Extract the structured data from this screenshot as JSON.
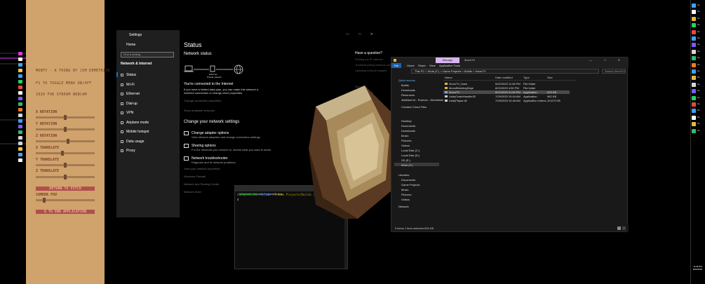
{
  "tool_panel": {
    "credit": "MONTY - A THING BY JIM DEMETRIOU",
    "toggle_hint": "F1 TO TOGGLE MENU ON/OFF",
    "stream_size": "1920 FOR STREAM WEBCAM",
    "sliders": [
      {
        "label": "X ROTATION",
        "value": 0.5
      },
      {
        "label": "Y ROTATION",
        "value": 0.5
      },
      {
        "label": "Z ROTATION",
        "value": 0.55
      },
      {
        "label": "X TRANSLATE",
        "value": 0.45
      },
      {
        "label": "Y TRANSLATE",
        "value": 0.5
      },
      {
        "label": "Z TRANSLATE",
        "value": 0.5
      }
    ],
    "reset_label": "RETURN TO PITCH",
    "fov_label": "CAMERA FOV",
    "fov_value": 0.12,
    "quit_label": "Q TO END APPLICATION"
  },
  "settings": {
    "window_title": "Settings",
    "home": "Home",
    "search_placeholder": "Find a setting",
    "category": "Network & Internet",
    "nav_items": [
      "Status",
      "Wi-Fi",
      "Ethernet",
      "Dial-up",
      "VPN",
      "Airplane mode",
      "Mobile hotspot",
      "Data usage",
      "Proxy"
    ],
    "heading": "Status",
    "network_status": "Network status",
    "ethernet_caption_1": "Ethernet",
    "ethernet_caption_2": "Private network",
    "connected": "You're connected to the Internet",
    "metered_text_1": "If you have a limited data plan, you can make this network a",
    "metered_text_2": "metered connection or change other properties.",
    "change_props": "Change connection properties",
    "show_networks": "Show available networks",
    "change_heading": "Change your network settings",
    "options": [
      {
        "title": "Change adapter options",
        "sub": "View network adapters and change connection settings."
      },
      {
        "title": "Sharing options",
        "sub": "For the networks you connect to, decide what you want to share."
      },
      {
        "title": "Network troubleshooter",
        "sub": "Diagnose and fix network problems."
      }
    ],
    "links": [
      "View your network properties",
      "Windows Firewall",
      "Network and Sharing Center",
      "Network reset"
    ],
    "question_title": "Have a question?",
    "question_links": [
      "Finding my IP address",
      "Troubleshooting network connection issues",
      "Updating network adapter"
    ],
    "help_links": [
      "Get help",
      "Give feedback"
    ]
  },
  "terminal": {
    "title": "MINGW64:/f/Game Projects/Builds",
    "prompt_user": "USER@MACHINE",
    "prompt_env": "MINGW64",
    "prompt_path": "/f/Game Projects/Builds",
    "prompt_branch": "(master)",
    "prompt_symbol": "$"
  },
  "explorer": {
    "tab_label": "Manage",
    "title": "3monTV",
    "window_controls": "— □ ✕",
    "ribbon": [
      "File",
      "Home",
      "Share",
      "View",
      "Application Tools"
    ],
    "address": "This PC  >  Work (F:)  >  Game Projects  >  Builds  >  3monTV",
    "search_placeholder": "Search 3monTV",
    "nav": [
      "Quick access",
      "Builds",
      "Downloads",
      "Resources",
      "3dsMaxCut - Rumors - Worldwide",
      "Creative Cloud Files",
      "Desktop",
      "Documents",
      "Downloads",
      "Music",
      "Pictures",
      "Videos",
      "Local Disk (C:)",
      "Local Disk (D:)",
      "SS (E:)",
      "Work (F:)",
      "Libraries",
      "Documents",
      "Game Projects",
      "Music",
      "Pictures",
      "Videos",
      "Network"
    ],
    "columns": [
      "Name",
      "Date modified",
      "Type",
      "Size"
    ],
    "files": [
      {
        "name": "3monTV_Data",
        "date": "8/22/2020 11:38 PM",
        "type": "File folder",
        "size": "",
        "color": "#e7b93a"
      },
      {
        "name": "MonoBleedingEdge",
        "date": "8/22/2020 4:50 PM",
        "type": "File folder",
        "size": "",
        "color": "#e7b93a"
      },
      {
        "name": "3monTV",
        "date": "8/22/2020 11:38 PM",
        "type": "Application",
        "size": "625 KB",
        "color": "#7aa5d8"
      },
      {
        "name": "UnityCrashHandler32",
        "date": "7/29/2020 10:44 AM",
        "type": "Application",
        "size": "962 KB",
        "color": "#cccccc"
      },
      {
        "name": "UnityPlayer.dll",
        "date": "7/29/2020 10:46 AM",
        "type": "Application extens...",
        "size": "19,573 KB",
        "color": "#cccccc"
      }
    ],
    "status": "5 items    1 item selected  625 KB"
  },
  "taskbar": {
    "time": "11:06 PM",
    "date": "8/22/2020",
    "items": [
      "Ne",
      "Ne",
      "Ne",
      "Ne",
      "Ne",
      "Ne",
      "Ne",
      "Ne",
      "Ne",
      "Ne",
      "Ne",
      "Ne",
      "Ne",
      "Ne",
      "Ne",
      "Ne",
      "Ne",
      "Ne",
      "Ne",
      "Ne"
    ]
  }
}
